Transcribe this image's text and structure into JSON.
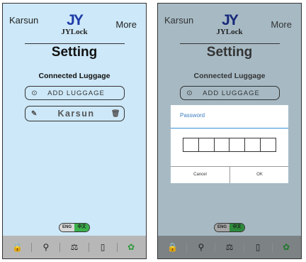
{
  "screens": [
    {
      "brand": "Karsun",
      "more": "More",
      "logo_mark": "JY",
      "logo_text": "JYLock",
      "title": "Setting",
      "section": "Connected Luggage",
      "add_luggage": "ADD LUGGAGE",
      "luggage_name": "Karsun",
      "lang_en": "ENG",
      "lang_zh": "中文",
      "background": "#cde8f8"
    },
    {
      "brand": "Karsun",
      "more": "More",
      "logo_mark": "JY",
      "logo_text": "JYLock",
      "title": "Setting",
      "section": "Connected Luggage",
      "add_luggage": "ADD LUGGAGE",
      "lang_en": "ENG",
      "lang_zh": "中文",
      "background": "#a7bac4",
      "dialog": {
        "title": "Password",
        "cancel": "Cancel",
        "ok": "OK",
        "digit_boxes": 6
      }
    }
  ],
  "tabbar": {
    "items": [
      "lock-icon",
      "location-pin-icon",
      "scale-icon",
      "battery-icon",
      "gear-icon"
    ],
    "glyphs": [
      "🔒",
      "⚲",
      "⚖",
      "▯",
      "✿"
    ],
    "active_color": "#2e9a3c"
  }
}
